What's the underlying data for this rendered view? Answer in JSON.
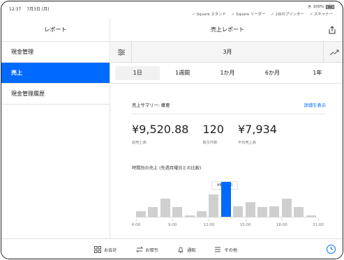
{
  "status": {
    "time": "12:37",
    "date": "7月3日 (月)",
    "devices": [
      "✓ Square スタンド",
      "✓ Square リーダー",
      "✓ 2台のプリンター",
      "✓ スキャナー"
    ],
    "battery_percent": "100%"
  },
  "sidebar": {
    "title": "レポート",
    "items": [
      {
        "label": "現金管理",
        "active": false
      },
      {
        "label": "売上",
        "active": true
      },
      {
        "label": "現金管理履歴",
        "active": false
      }
    ]
  },
  "main": {
    "title": "売上レポート",
    "filter_month": "3月",
    "tabs": [
      {
        "label": "1日",
        "active": true
      },
      {
        "label": "1週間",
        "active": false
      },
      {
        "label": "1か月",
        "active": false
      },
      {
        "label": "6か月",
        "active": false
      },
      {
        "label": "1年",
        "active": false
      }
    ]
  },
  "summary": {
    "title": "売上サマリー: 概要",
    "details_link": "詳細を表示",
    "metrics": [
      {
        "value": "¥9,520.88",
        "label": "総売上高"
      },
      {
        "value": "120",
        "label": "取引件数"
      },
      {
        "value": "¥7,934",
        "label": "平均売上高"
      }
    ]
  },
  "hourly": {
    "title": "時間別の売上 (先週月曜日との比較)",
    "tooltip": "¥855.20"
  },
  "chart_data": {
    "type": "bar",
    "categories": [
      "6:00",
      "7:00",
      "8:00",
      "9:00",
      "10:00",
      "11:00",
      "12:00",
      "13:00",
      "14:00",
      "15:00",
      "16:00",
      "17:00",
      "18:00",
      "19:00",
      "20:00"
    ],
    "values": [
      145,
      255,
      455,
      255,
      45,
      145,
      555,
      855.2,
      275,
      360,
      245,
      275,
      455,
      255,
      45
    ],
    "selected_index": 7,
    "x_tick_labels": [
      "6:00",
      "9:00",
      "12:00",
      "15:00",
      "18:00",
      "21:00"
    ],
    "colors": {
      "default": "#cfcfcf",
      "selected": "#006aff"
    }
  },
  "bottom_nav": {
    "items": [
      "お会計",
      "お取引",
      "通知",
      "その他"
    ]
  },
  "colors": {
    "accent": "#006aff"
  }
}
